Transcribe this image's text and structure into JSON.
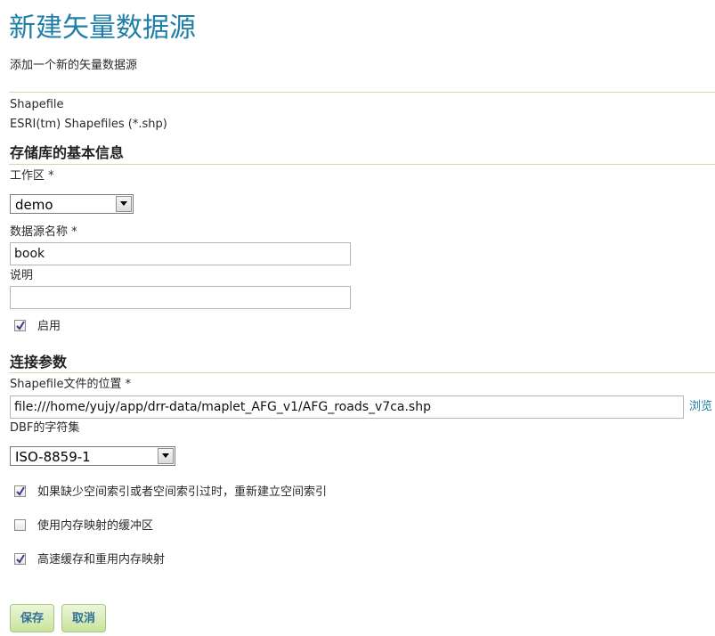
{
  "header": {
    "title": "新建矢量数据源",
    "subtitle": "添加一个新的矢量数据源"
  },
  "store_type": {
    "name": "Shapefile",
    "description": "ESRI(tm) Shapefiles (*.shp)"
  },
  "basic_info": {
    "section_title": "存储库的基本信息",
    "workspace_label": "工作区 *",
    "workspace_value": "demo",
    "name_label": "数据源名称 *",
    "name_value": "book",
    "description_label": "说明",
    "description_value": "",
    "enabled_label": "启用",
    "enabled_checked": true
  },
  "connection": {
    "section_title": "连接参数",
    "location_label": "Shapefile文件的位置 *",
    "location_value": "file:///home/yujy/app/drr-data/maplet_AFG_v1/AFG_roads_v7ca.shp",
    "browse_label": "浏览",
    "charset_label": "DBF的字符集",
    "charset_value": "ISO-8859-1",
    "options": [
      {
        "label": "如果缺少空间索引或者空间索引过时，重新建立空间索引",
        "checked": true
      },
      {
        "label": "使用内存映射的缓冲区",
        "checked": false
      },
      {
        "label": "高速缓存和重用内存映射",
        "checked": true
      }
    ]
  },
  "actions": {
    "save_label": "保存",
    "cancel_label": "取消"
  },
  "colors": {
    "title": "#1f7fa8",
    "rule": "#d6d6b2",
    "button_bg": "#c8e39c",
    "link": "#1f7fa8"
  }
}
